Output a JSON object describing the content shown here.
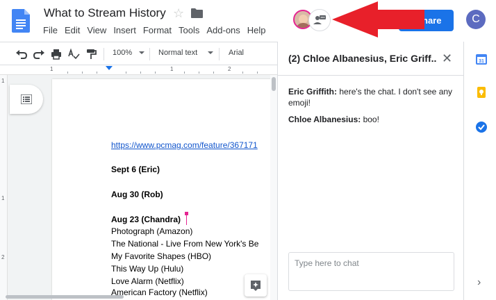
{
  "document": {
    "title": "What to Stream History",
    "menu": [
      "File",
      "Edit",
      "View",
      "Insert",
      "Format",
      "Tools",
      "Add-ons",
      "Help"
    ],
    "share_label": "Share",
    "share_visible_label": "hare",
    "account_initial": "C"
  },
  "toolbar": {
    "zoom": "100%",
    "style": "Normal text",
    "font": "Arial"
  },
  "ruler": {
    "numbers": [
      "1",
      "1",
      "2"
    ],
    "vertical_numbers": [
      "1",
      "1",
      "2"
    ]
  },
  "content": {
    "link": "https://www.pcmag.com/feature/367171",
    "lines": [
      {
        "text": "Sept 6 (Eric)",
        "bold": true
      },
      {
        "text": "Aug 30 (Rob)",
        "bold": true
      },
      {
        "text": "Aug 23 (Chandra)",
        "bold": true
      },
      {
        "text": "Photograph (Amazon)",
        "bold": false
      },
      {
        "text": "The National - Live From New York's Be",
        "bold": false
      },
      {
        "text": "My Favorite Shapes (HBO)",
        "bold": false
      },
      {
        "text": "This Way Up (Hulu)",
        "bold": false
      },
      {
        "text": "Love Alarm (Netflix)",
        "bold": false
      },
      {
        "text": "American Factory (Netflix)",
        "bold": false
      }
    ]
  },
  "chat": {
    "title": "(2) Chloe Albanesius, Eric Griff...",
    "messages": [
      {
        "author": "Eric Griffith:",
        "text": " here's the chat. I don't see any emoji!"
      },
      {
        "author": "Chloe Albanesius:",
        "text": " boo!"
      }
    ],
    "input_placeholder": "Type here to chat"
  },
  "colors": {
    "accent": "#1a73e8",
    "arrow": "#e8202a",
    "cursor": "#e52592",
    "avatar": "#5c6bc0"
  },
  "icons": [
    "docs-logo-icon",
    "star-icon",
    "folder-icon",
    "chat-people-icon",
    "undo-icon",
    "redo-icon",
    "print-icon",
    "spellcheck-icon",
    "paint-format-icon",
    "outline-icon",
    "explore-icon",
    "close-icon",
    "calendar-icon",
    "keep-icon",
    "tasks-icon",
    "chevron-right-icon"
  ]
}
